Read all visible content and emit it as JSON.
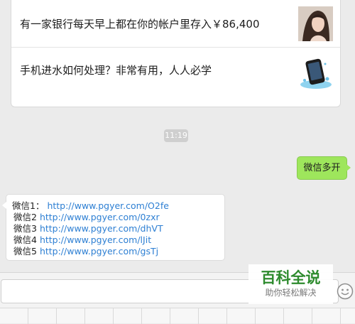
{
  "news": {
    "items": [
      {
        "title": "有一家银行每天早上都在你的帐户里存入￥86,400",
        "thumb_icon": "portrait-photo-icon"
      },
      {
        "title": "手机进水如何处理？非常有用，人人必学",
        "thumb_icon": "wet-phone-photo-icon"
      }
    ]
  },
  "chat": {
    "timestamp": "11:19",
    "outgoing": {
      "text": "微信多开"
    },
    "incoming": {
      "lines": [
        {
          "label": "微信1：",
          "url": "http://www.pgyer.com/O2fe"
        },
        {
          "label": "微信2",
          "url": "http://www.pgyer.com/0zxr"
        },
        {
          "label": "微信3",
          "url": "http://www.pgyer.com/dhVT"
        },
        {
          "label": "微信4",
          "url": "http://www.pgyer.com/lJit"
        },
        {
          "label": "微信5",
          "url": "http://www.pgyer.com/gsTj"
        }
      ]
    }
  },
  "watermark": {
    "main": "百科全说",
    "sub": "助你轻松解决"
  },
  "input": {
    "value": "",
    "placeholder": ""
  },
  "colors": {
    "bubble_out": "#9ee65c",
    "link": "#2d7fd3",
    "watermark": "#2e8b2e"
  }
}
